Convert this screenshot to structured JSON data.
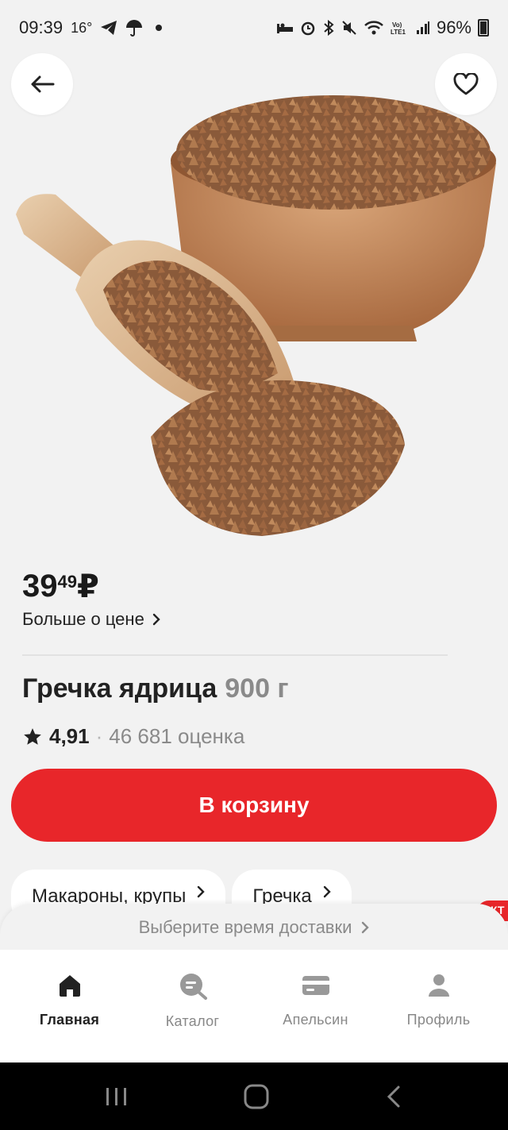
{
  "status": {
    "time": "09:39",
    "temp": "16°",
    "battery": "96%"
  },
  "product": {
    "price_main": "39",
    "price_kop": "49",
    "currency": "₽",
    "more_price": "Больше о цене",
    "name": "Гречка ядрица",
    "weight": "900 г",
    "rating": "4,91",
    "reviews": "46 681 оценка",
    "cart_label": "В корзину"
  },
  "chips": [
    {
      "label": "Макароны, крупы"
    },
    {
      "label": "Гречка"
    }
  ],
  "delivery": {
    "label": "Выберите время доставки",
    "tag": "КТ"
  },
  "tabs": [
    {
      "label": "Главная"
    },
    {
      "label": "Каталог"
    },
    {
      "label": "Апельсин"
    },
    {
      "label": "Профиль"
    }
  ],
  "colors": {
    "accent": "#e8262a",
    "background": "#f2f2f2"
  }
}
